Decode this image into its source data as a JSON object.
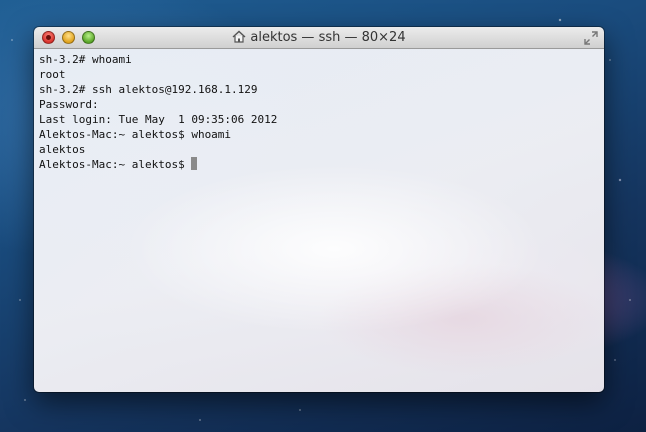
{
  "window": {
    "title": "alektos — ssh — 80×24",
    "title_icon": "home-icon"
  },
  "terminal": {
    "lines": [
      "sh-3.2# whoami",
      "root",
      "sh-3.2# ssh alektos@192.168.1.129",
      "Password:",
      "Last login: Tue May  1 09:35:06 2012",
      "Alektos-Mac:~ alektos$ whoami",
      "alektos"
    ],
    "prompt": "Alektos-Mac:~ alektos$ "
  },
  "colors": {
    "close": "#d9322b",
    "minimize": "#e0a21c",
    "zoom": "#5aa628",
    "cursor": "#8a8a8a"
  }
}
